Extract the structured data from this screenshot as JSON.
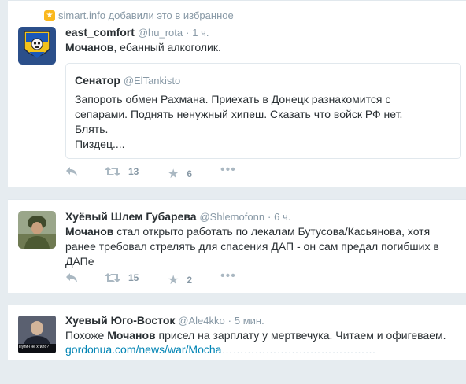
{
  "tweets": [
    {
      "context": "simart.info добавили это в избранное",
      "fullname": "east_comfort",
      "username": "@hu_rota",
      "sep": "·",
      "time": "1 ч.",
      "mention": "Мочанов",
      "text": ", ебанный алкоголик.",
      "quote": {
        "fullname": "Сенатор",
        "username": "@ElTankisto",
        "text": "Запороть обмен Рахмана. Приехать в Донецк разнакомится с\nсепарами. Поднять ненужный хипеш. Сказать что войск РФ нет.\nБлять.\nПиздец...."
      },
      "retweets": "13",
      "favorites": "6"
    },
    {
      "fullname": "Хуёвый Шлем Губарева",
      "username": "@Shlemofonn",
      "sep": "·",
      "time": "6 ч.",
      "mention": "Мочанов",
      "text": " стал открыто работать по лекалам Бутусова/Касьянова, хотя ранее требовал стрелять для спасения ДАП - он сам предал погибших в ДАПе",
      "retweets": "15",
      "favorites": "2"
    },
    {
      "fullname": "Хуевый Юго-Восток",
      "username": "@Ale4kko",
      "sep": "·",
      "time": "5 мин.",
      "text_before": "Похоже ",
      "mention": "Мочанов",
      "text_after": " присел на зарплату у мертвечука. Читаем и офигеваем.",
      "link": "gordonua.com/news/war/Mocha",
      "link_tail": "……………………………………",
      "avatar_caption": "Путин не х*йло?"
    }
  ],
  "icons": {
    "reply": "reply-icon",
    "retweet": "retweet-icon",
    "favorite": "star-icon",
    "more": "more-icon"
  }
}
